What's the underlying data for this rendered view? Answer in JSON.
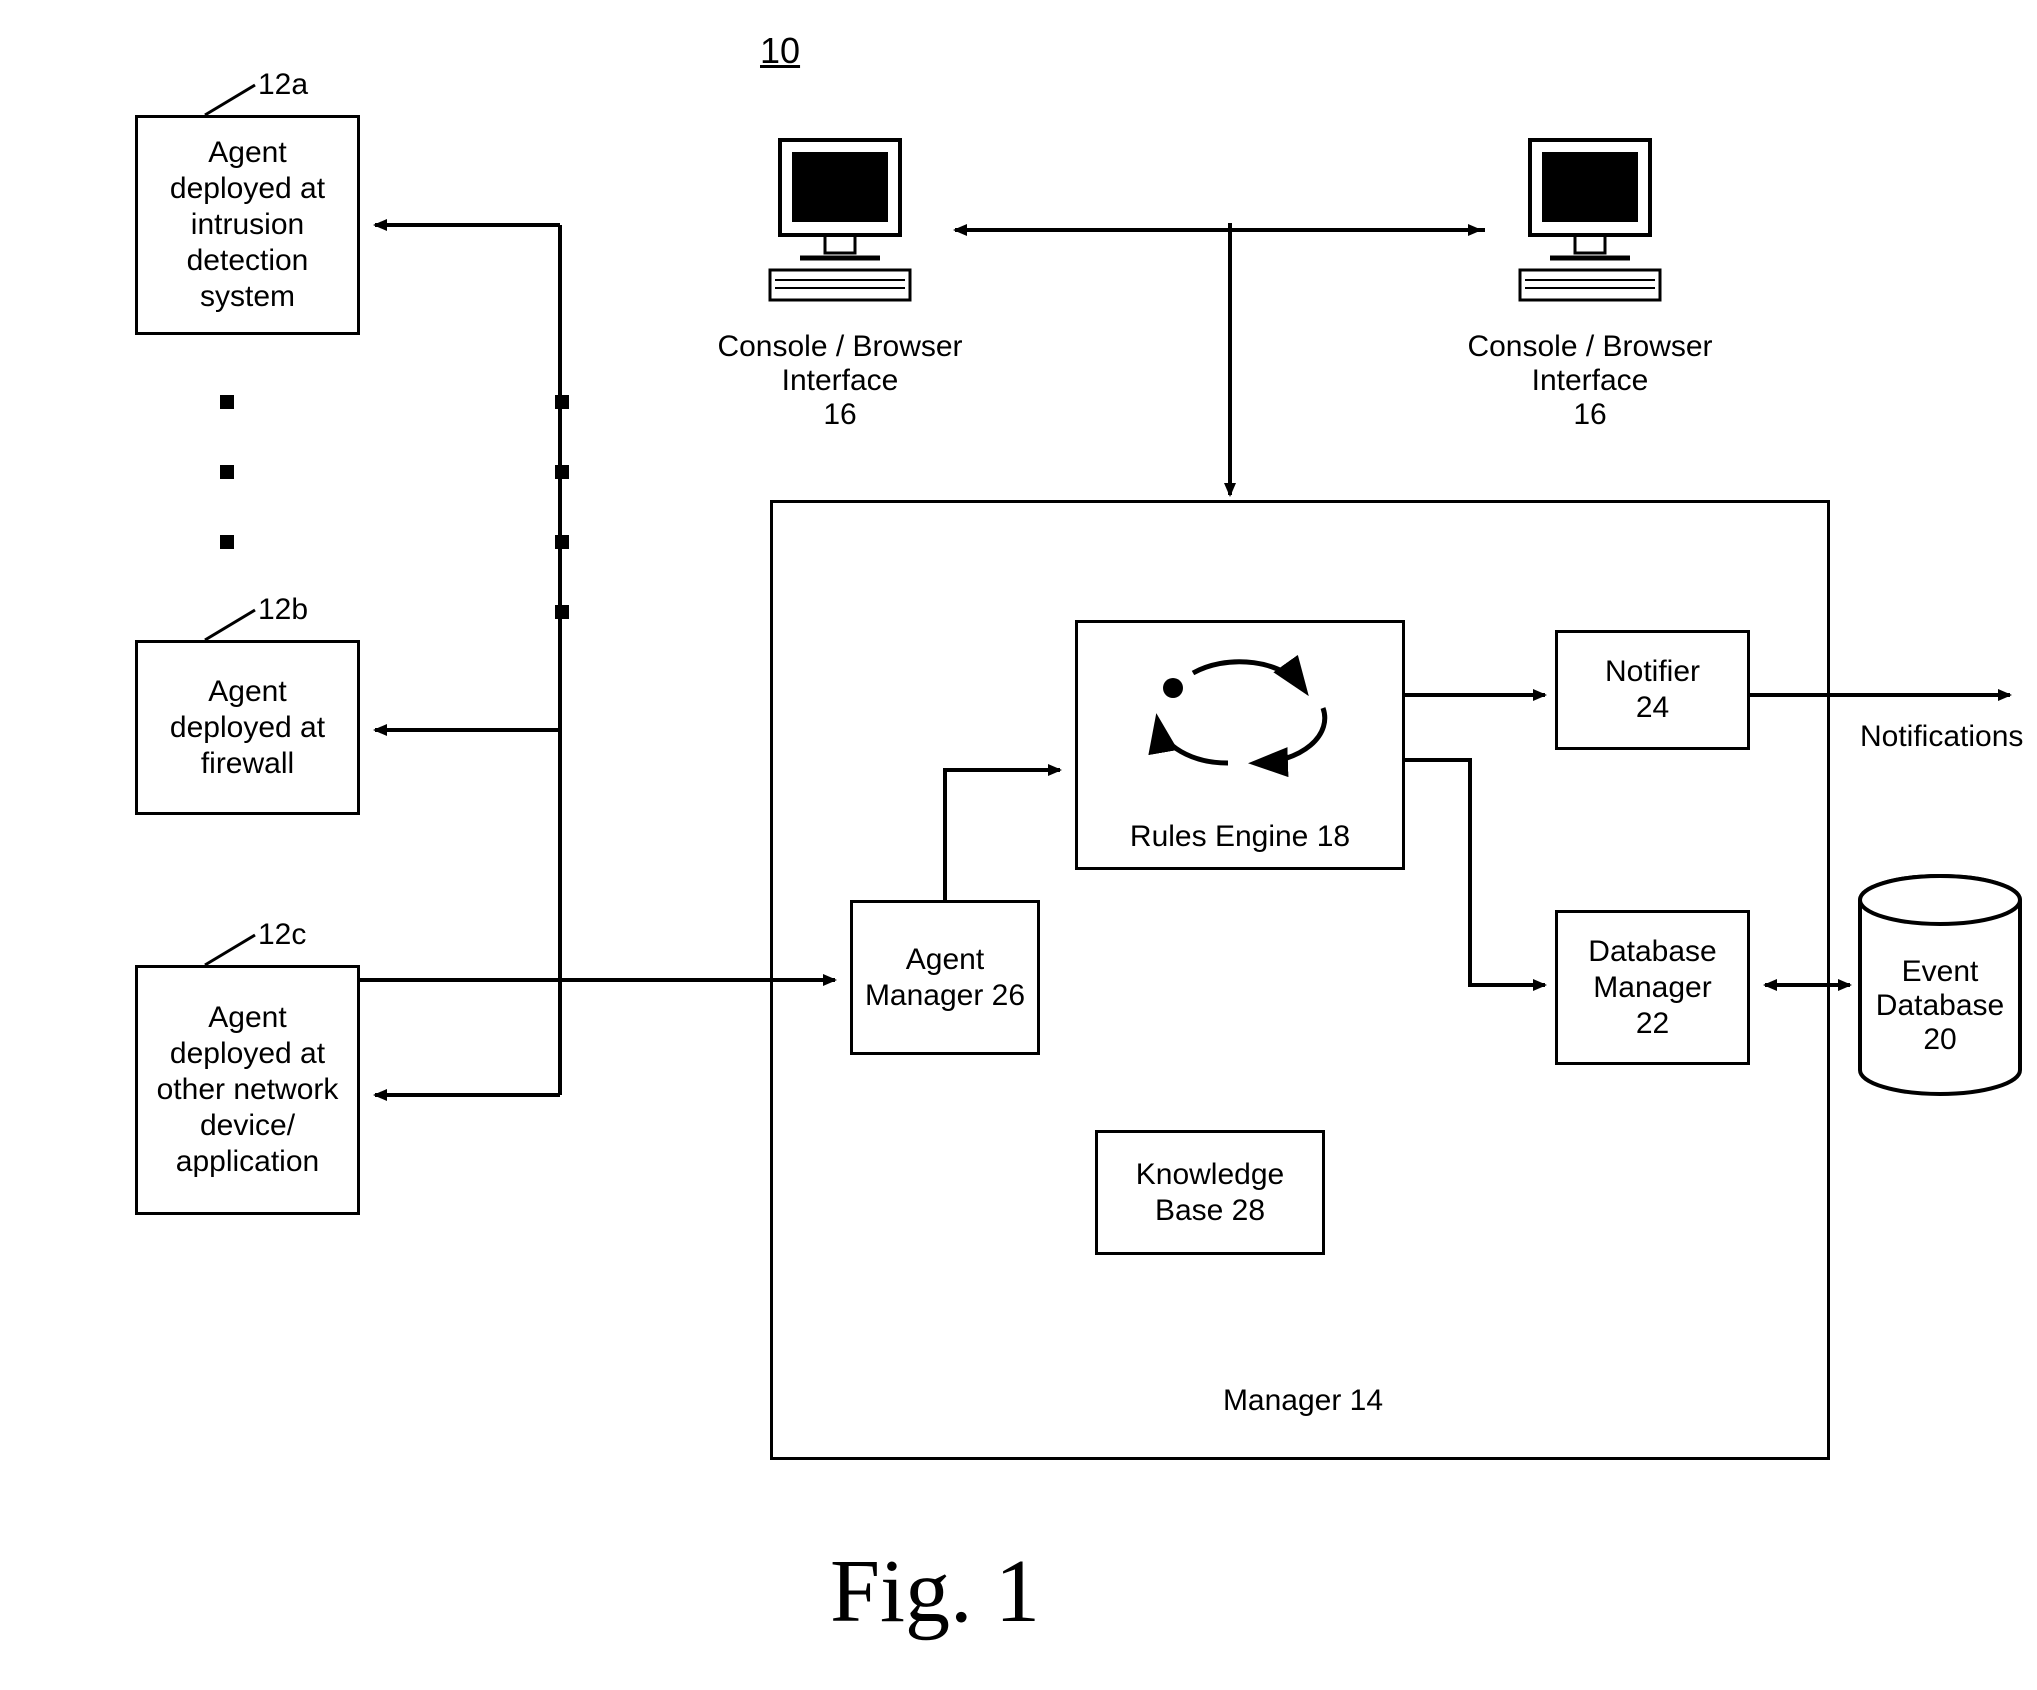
{
  "figure_number": "10",
  "figure_caption": "Fig. 1",
  "agents": {
    "a": {
      "ref": "12a",
      "text": "Agent deployed at intrusion detection system"
    },
    "b": {
      "ref": "12b",
      "text": "Agent deployed at firewall"
    },
    "c": {
      "ref": "12c",
      "text": "Agent deployed at other network device/ application"
    }
  },
  "consoles": {
    "left": {
      "label": "Console / Browser Interface",
      "num": "16"
    },
    "right": {
      "label": "Console / Browser Interface",
      "num": "16"
    }
  },
  "manager": {
    "label": "Manager 14",
    "rules_engine": "Rules Engine 18",
    "agent_manager": "Agent Manager 26",
    "notifier": {
      "label": "Notifier",
      "num": "24"
    },
    "db_manager": {
      "label": "Database Manager",
      "num": "22"
    },
    "knowledge_base": "Knowledge Base 28"
  },
  "event_db": {
    "label": "Event Database",
    "num": "20"
  },
  "notifications_label": "Notifications"
}
